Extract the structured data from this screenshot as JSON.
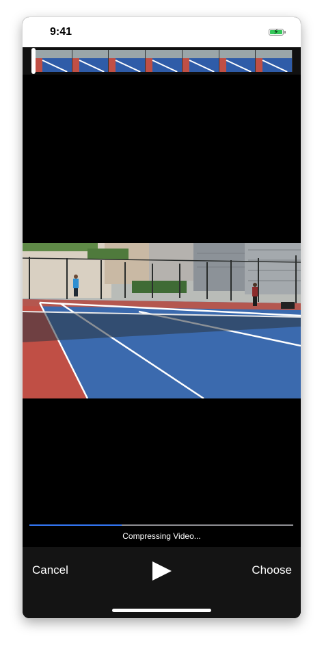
{
  "status_bar": {
    "time": "9:41",
    "battery_icon": "battery-charging-icon",
    "battery_color": "#34c759"
  },
  "trim_bar": {
    "thumbnail_count": 7,
    "handle_icon": "trim-handle-icon"
  },
  "video": {
    "description_icon": "video-preview"
  },
  "compression": {
    "label": "Compressing Video...",
    "progress": 0.35,
    "track_color": "#8e8e93",
    "fill_color": "#3478f6"
  },
  "toolbar": {
    "cancel_label": "Cancel",
    "choose_label": "Choose",
    "play_icon": "play-icon"
  }
}
